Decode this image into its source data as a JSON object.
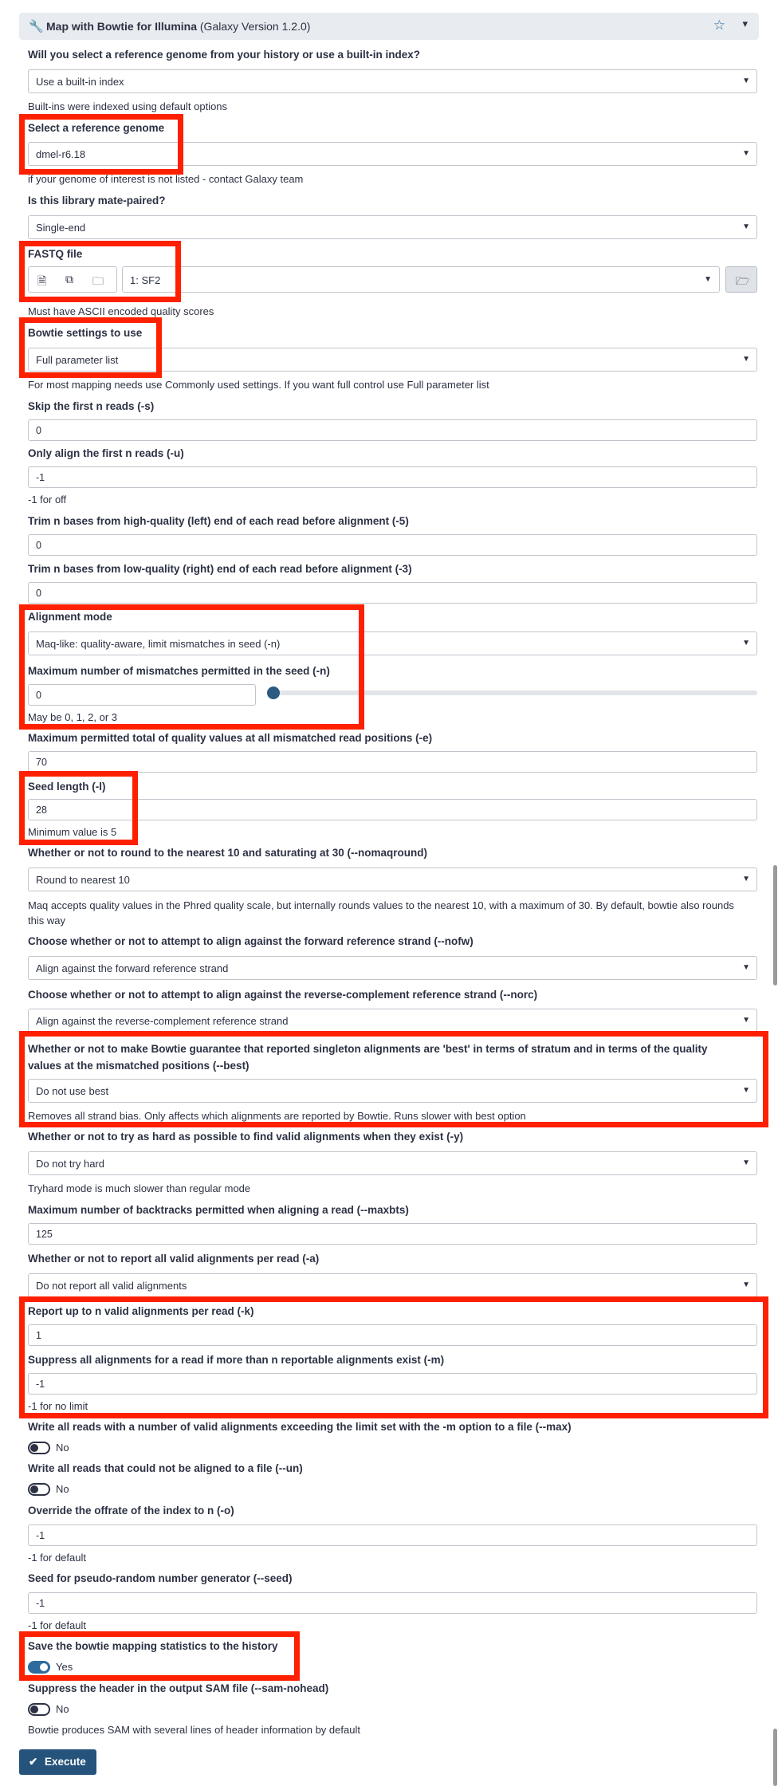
{
  "tool": {
    "name": "Map with Bowtie for Illumina",
    "version": "(Galaxy Version 1.2.0)"
  },
  "fields": {
    "ref_source": {
      "label": "Will you select a reference genome from your history or use a built-in index?",
      "value": "Use a built-in index",
      "help": "Built-ins were indexed using default options"
    },
    "ref_genome": {
      "label": "Select a reference genome",
      "value": "dmel-r6.18",
      "help": "if your genome of interest is not listed - contact Galaxy team"
    },
    "mate_paired": {
      "label": "Is this library mate-paired?",
      "value": "Single-end"
    },
    "fastq": {
      "label": "FASTQ file",
      "value": "1: SF2",
      "help": "Must have ASCII encoded quality scores"
    },
    "settings": {
      "label": "Bowtie settings to use",
      "value": "Full parameter list",
      "help": "For most mapping needs use Commonly used settings. If you want full control use Full parameter list"
    },
    "skip": {
      "label": "Skip the first n reads (-s)",
      "value": "0"
    },
    "align_first": {
      "label": "Only align the first n reads (-u)",
      "value": "-1",
      "help": "-1 for off"
    },
    "trim5": {
      "label": "Trim n bases from high-quality (left) end of each read before alignment (-5)",
      "value": "0"
    },
    "trim3": {
      "label": "Trim n bases from low-quality (right) end of each read before alignment (-3)",
      "value": "0"
    },
    "align_mode": {
      "label": "Alignment mode",
      "value": "Maq-like: quality-aware, limit mismatches in seed (-n)"
    },
    "mismatches": {
      "label": "Maximum number of mismatches permitted in the seed (-n)",
      "value": "0",
      "help": "May be 0, 1, 2, or 3",
      "slider_fraction": 0
    },
    "max_quality": {
      "label": "Maximum permitted total of quality values at all mismatched read positions (-e)",
      "value": "70"
    },
    "seed_length": {
      "label": "Seed length (-l)",
      "value": "28",
      "help": "Minimum value is 5"
    },
    "round": {
      "label": "Whether or not to round to the nearest 10 and saturating at 30 (--nomaqround)",
      "value": "Round to nearest 10",
      "help": "Maq accepts quality values in the Phred quality scale, but internally rounds values to the nearest 10, with a maximum of 30. By default, bowtie also rounds this way"
    },
    "nofw": {
      "label": "Choose whether or not to attempt to align against the forward reference strand (--nofw)",
      "value": "Align against the forward reference strand"
    },
    "norc": {
      "label": "Choose whether or not to attempt to align against the reverse-complement reference strand (--norc)",
      "value": "Align against the reverse-complement reference strand"
    },
    "best": {
      "label": "Whether or not to make Bowtie guarantee that reported singleton alignments are 'best' in terms of stratum and in terms of the quality values at the mismatched positions (--best)",
      "value": "Do not use best",
      "help": "Removes all strand bias. Only affects which alignments are reported by Bowtie. Runs slower with best option"
    },
    "tryhard": {
      "label": "Whether or not to try as hard as possible to find valid alignments when they exist (-y)",
      "value": "Do not try hard",
      "help": "Tryhard mode is much slower than regular mode"
    },
    "maxbts": {
      "label": "Maximum number of backtracks permitted when aligning a read (--maxbts)",
      "value": "125"
    },
    "all": {
      "label": "Whether or not to report all valid alignments per read (-a)",
      "value": "Do not report all valid alignments"
    },
    "k": {
      "label": "Report up to n valid alignments per read (-k)",
      "value": "1"
    },
    "m": {
      "label": "Suppress all alignments for a read if more than n reportable alignments exist (-m)",
      "value": "-1",
      "help": "-1 for no limit"
    },
    "max": {
      "label": "Write all reads with a number of valid alignments exceeding the limit set with the -m option to a file (--max)",
      "value": "No"
    },
    "un": {
      "label": "Write all reads that could not be aligned to a file (--un)",
      "value": "No"
    },
    "offrate": {
      "label": "Override the offrate of the index to n (-o)",
      "value": "-1",
      "help": "-1 for default"
    },
    "seed": {
      "label": "Seed for pseudo-random number generator (--seed)",
      "value": "-1",
      "help": "-1 for default"
    },
    "stats": {
      "label": "Save the bowtie mapping statistics to the history",
      "value": "Yes"
    },
    "nohead": {
      "label": "Suppress the header in the output SAM file (--sam-nohead)",
      "value": "No",
      "help": "Bowtie produces SAM with several lines of header information by default"
    }
  },
  "execute": {
    "label": "Execute"
  },
  "icons": [
    "wrench-icon",
    "star-icon",
    "caret-down-icon",
    "file-icon",
    "files-icon",
    "folder-icon",
    "folder-open-icon",
    "check-icon"
  ],
  "colors": {
    "highlight": "#ff2000",
    "accent": "#25537b",
    "header_bg": "#e8ebef"
  }
}
